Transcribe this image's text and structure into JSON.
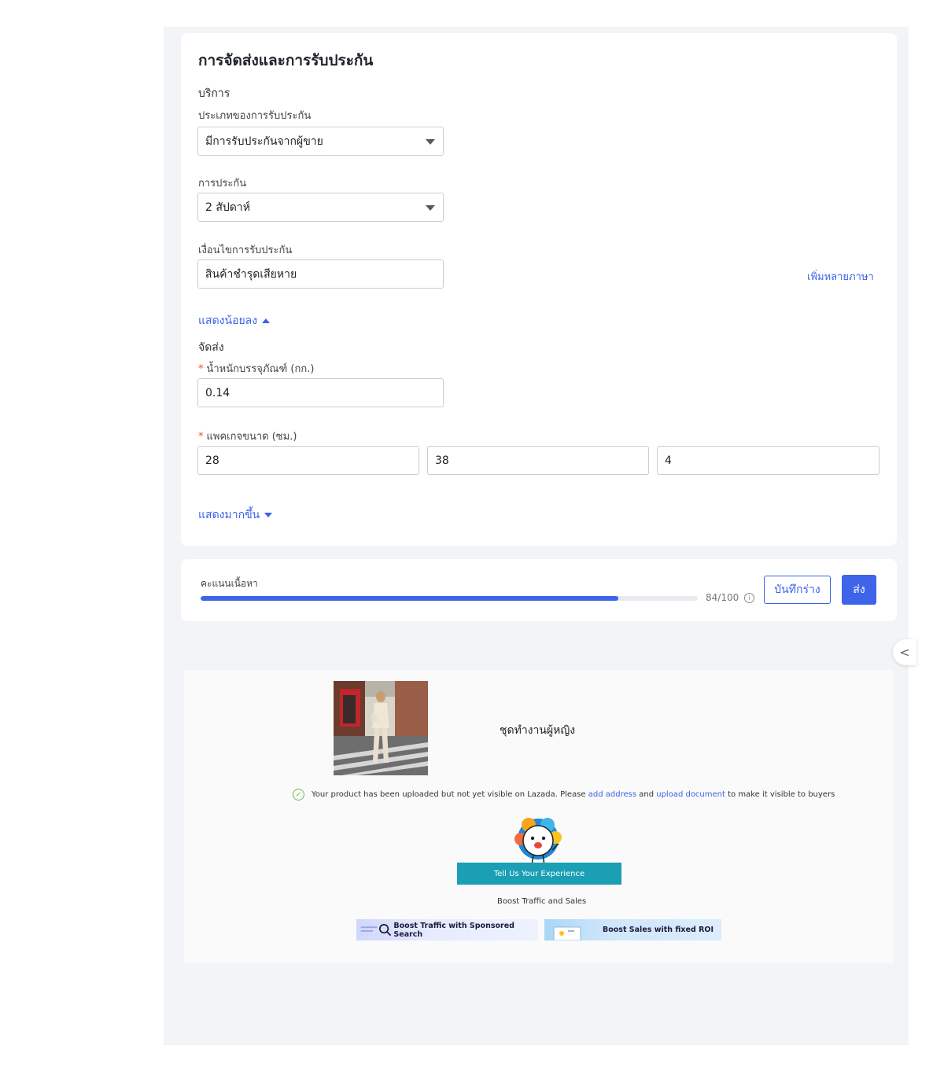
{
  "shipping_card": {
    "title": "การจัดส่งและการรับประกัน",
    "service_heading": "บริการ",
    "warranty_type": {
      "label": "ประเภทของการรับประกัน",
      "value": "มีการรับประกันจากผู้ขาย"
    },
    "warranty": {
      "label": "การประกัน",
      "value": "2 สัปดาห์"
    },
    "warranty_policy": {
      "label": "เงื่อนไขการรับประกัน",
      "value": "สินค้าชำรุดเสียหาย"
    },
    "multi_language_link": "เพิ่มหลายภาษา",
    "show_less": "แสดงน้อยลง",
    "delivery_heading": "จัดส่ง",
    "required_mark": "*",
    "package_weight": {
      "label": "น้ำหนักบรรจุภัณฑ์ (กก.)",
      "value": "0.14"
    },
    "package_dimensions": {
      "label": "แพคเกจขนาด (ซม.)",
      "length": "28",
      "width": "38",
      "height": "4"
    },
    "show_more": "แสดงมากขึ้น"
  },
  "score_bar": {
    "label": "คะแนนเนื้อหา",
    "score_text": "84/100",
    "score_fraction": 0.84,
    "save_draft": "บันทึกร่าง",
    "submit": "ส่ง"
  },
  "collapse_glyph": "<",
  "success_panel": {
    "product_name": "ชุดทำงานผู้หญิง",
    "notice_prefix": "Your product has been uploaded but not yet visible on Lazada. Please ",
    "notice_link1": "add address",
    "notice_and": " and ",
    "notice_link2": "upload document",
    "notice_suffix": " to make it visible to buyers",
    "feedback_button": "Tell Us Your Experience",
    "boost_heading": "Boost Traffic and Sales",
    "banner1": "Boost Traffic with Sponsored Search",
    "banner2": "Boost Sales with fixed ROI"
  },
  "colors": {
    "accent": "#3e64e9",
    "teal": "#1a9fb5",
    "success": "#6fbf40",
    "required": "#f04b3e"
  }
}
